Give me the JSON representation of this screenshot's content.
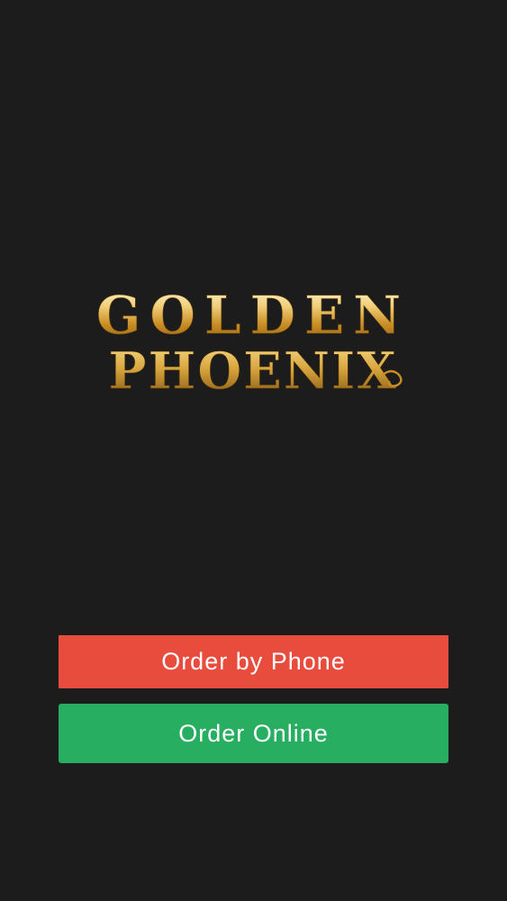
{
  "logo": {
    "line1": "GOLDEN",
    "line2": "PHOENIX"
  },
  "buttons": {
    "order_by_phone": "Order by Phone",
    "order_online": "Order Online"
  },
  "colors": {
    "background": "#1c1c1d",
    "order_by_phone": "#e74c3c",
    "order_online": "#27ae60",
    "logo_gold": "#d9a63e"
  }
}
